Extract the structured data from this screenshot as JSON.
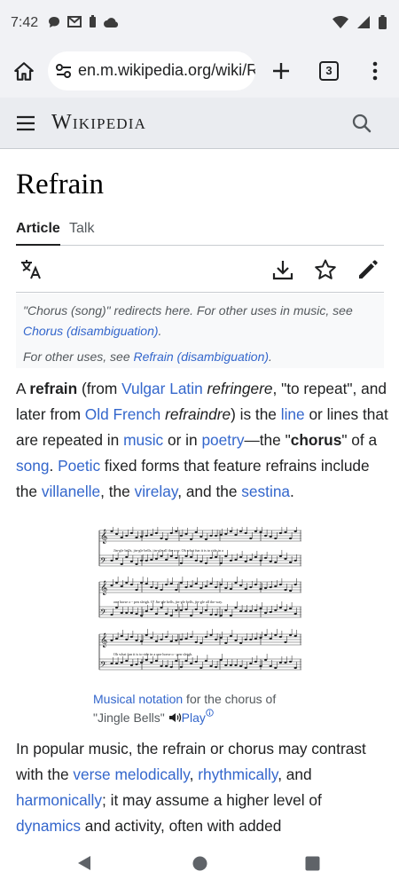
{
  "status": {
    "time": "7:42"
  },
  "browser": {
    "url": "en.m.wikipedia.org/wiki/Refrain",
    "tab_count": "3"
  },
  "wiki": {
    "wordmark": "Wikipedia"
  },
  "article": {
    "title": "Refrain",
    "tabs": [
      {
        "label": "Article",
        "active": true
      },
      {
        "label": "Talk",
        "active": false
      }
    ],
    "hatnote": {
      "line1_prefix": "\"Chorus (song)\" redirects here. For other uses in music, see ",
      "line1_link": "Chorus (disambiguation)",
      "line1_suffix": ".",
      "line2_prefix": "For other uses, see ",
      "line2_link": "Refrain (disambiguation)",
      "line2_suffix": "."
    },
    "para1": {
      "t1": "A ",
      "b1": "refrain",
      "t2": " (from ",
      "l1": "Vulgar Latin",
      "t3": " ",
      "i1": "refringere",
      "t4": ", \"to repeat\", and later from ",
      "l2": "Old French",
      "t5": " ",
      "i2": "refraindre",
      "t6": ") is the ",
      "l3": "line",
      "t7": " or lines that are repeated in ",
      "l4": "music",
      "t8": " or in ",
      "l5": "poetry",
      "t9": "—the \"",
      "b2": "chorus",
      "t10": "\" of a ",
      "l6": "song",
      "t11": ". ",
      "l7": "Poetic",
      "t12": " fixed forms that feature refrains include the ",
      "l8": "villanelle",
      "t13": ", the ",
      "l9": "virelay",
      "t14": ", and the ",
      "l10": "sestina",
      "t15": "."
    },
    "figure": {
      "lyrics1": "Jin-gle bells, jin-gle bells,   jin-gle all  the way.      Oh  what fun   it  is   to ride  in a",
      "lyrics2": "one horse  o - pen sleigh. O!    Jin-gle bells, jin-gle bells,   jin-gle all  the way.",
      "lyrics3": "Oh  what  fun    it    is    to  ride  in   a    one  horse  o - pen  sleigh.",
      "caption_link": "Musical notation",
      "caption_text": " for the chorus of \"Jingle Bells\" ",
      "play_label": "Play"
    },
    "para2": {
      "t1": "In popular music, the refrain or chorus may contrast with the ",
      "l1": "verse",
      "t2": " ",
      "l2": "melodically",
      "t3": ", ",
      "l3": "rhythmically",
      "t4": ", and ",
      "l4": "harmonically",
      "t5": "; it may assume a higher level of ",
      "l5": "dynamics",
      "t6": " and activity, often with added"
    }
  },
  "colors": {
    "link": "#3366cc",
    "text": "#202122",
    "chrome": "#f1f2f5",
    "header": "#eaecf0"
  },
  "icons": [
    "home-icon",
    "tune-icon",
    "plus-icon",
    "more-vert-icon",
    "hamburger-icon",
    "search-icon",
    "translate-icon",
    "download-icon",
    "star-icon",
    "edit-icon",
    "speaker-icon",
    "back-icon",
    "home-circle-icon",
    "recents-icon"
  ]
}
